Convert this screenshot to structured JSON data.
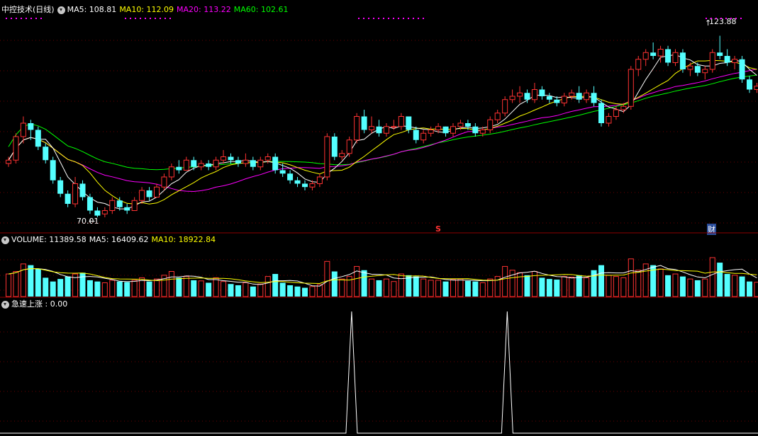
{
  "panels": {
    "price": {
      "title": "中控技术(日线)",
      "indicators": [
        {
          "label": "MA5: 108.81",
          "color": "#ffffff"
        },
        {
          "label": "MA10: 112.09",
          "color": "#ffff00"
        },
        {
          "label": "MA20: 113.22",
          "color": "#ff00ff"
        },
        {
          "label": "MA60: 102.61",
          "color": "#00ff00"
        }
      ],
      "high_label": "123.88",
      "low_label": "70.01",
      "marker_s": "S",
      "marker_cai": "财"
    },
    "volume": {
      "title": "VOLUME: 11389.58",
      "indicators": [
        {
          "label": "MA5: 16409.62",
          "color": "#ffffff"
        },
        {
          "label": "MA10: 18922.84",
          "color": "#ffff00"
        }
      ]
    },
    "signal": {
      "title": "急速上涨 : 0.00"
    }
  },
  "colors": {
    "up": "#ff3232",
    "down": "#54ffff",
    "ma5": "#ffffff",
    "ma10": "#ffff00",
    "ma20": "#ff00ff",
    "ma60": "#00ff00",
    "grid": "#8b0000",
    "dots": "#ff00ff"
  },
  "chart_data": {
    "type": "candlestick",
    "price_range": [
      66,
      130
    ],
    "candles": [
      [
        86,
        88,
        85,
        87
      ],
      [
        87,
        95,
        86,
        94
      ],
      [
        94,
        100,
        92,
        98
      ],
      [
        98,
        99,
        93,
        96
      ],
      [
        96,
        97,
        90,
        91
      ],
      [
        91,
        92,
        86,
        87
      ],
      [
        87,
        88,
        80,
        81
      ],
      [
        81,
        82,
        76,
        77
      ],
      [
        77,
        78,
        73,
        74
      ],
      [
        74,
        82,
        73,
        80
      ],
      [
        80,
        81,
        75,
        76
      ],
      [
        76,
        77,
        71,
        72
      ],
      [
        72,
        73,
        70,
        70.5
      ],
      [
        71,
        73,
        70,
        72
      ],
      [
        72,
        76,
        71,
        75
      ],
      [
        75,
        76,
        72,
        73
      ],
      [
        73,
        74,
        71,
        72
      ],
      [
        72,
        76,
        72,
        75
      ],
      [
        75,
        79,
        74,
        78
      ],
      [
        78,
        79,
        75,
        76
      ],
      [
        76,
        80,
        76,
        79
      ],
      [
        79,
        83,
        78,
        82
      ],
      [
        82,
        86,
        81,
        85
      ],
      [
        85,
        87,
        83,
        84
      ],
      [
        84,
        88,
        84,
        87
      ],
      [
        87,
        88,
        84,
        85
      ],
      [
        85,
        87,
        84,
        86
      ],
      [
        86,
        87,
        84,
        85
      ],
      [
        85,
        88,
        84,
        87
      ],
      [
        87,
        90,
        86,
        88
      ],
      [
        88,
        89,
        86,
        87
      ],
      [
        87,
        88,
        85,
        86
      ],
      [
        86,
        89,
        85,
        87
      ],
      [
        87,
        88,
        84,
        85
      ],
      [
        85,
        88,
        84,
        87
      ],
      [
        87,
        89,
        86,
        88
      ],
      [
        88,
        89,
        83,
        84
      ],
      [
        84,
        86,
        82,
        83
      ],
      [
        83,
        84,
        80,
        81
      ],
      [
        81,
        82,
        79,
        80
      ],
      [
        80,
        81,
        78,
        79
      ],
      [
        79,
        81,
        78,
        80
      ],
      [
        80,
        83,
        79,
        82
      ],
      [
        82,
        95,
        81,
        94
      ],
      [
        94,
        95,
        87,
        88
      ],
      [
        88,
        90,
        87,
        89
      ],
      [
        89,
        94,
        88,
        93
      ],
      [
        93,
        101,
        92,
        100
      ],
      [
        100,
        102,
        95,
        96
      ],
      [
        96,
        100,
        95,
        97
      ],
      [
        97,
        99,
        94,
        95
      ],
      [
        95,
        98,
        94,
        97
      ],
      [
        97,
        99,
        96,
        97
      ],
      [
        97,
        101,
        96,
        100
      ],
      [
        100,
        100,
        95,
        96
      ],
      [
        96,
        97,
        92,
        93
      ],
      [
        93,
        96,
        92,
        95
      ],
      [
        95,
        97,
        94,
        96
      ],
      [
        96,
        98,
        95,
        97
      ],
      [
        97,
        97,
        94,
        95
      ],
      [
        95,
        98,
        94,
        97
      ],
      [
        97,
        99,
        96,
        98
      ],
      [
        98,
        99,
        96,
        97
      ],
      [
        97,
        98,
        94,
        95
      ],
      [
        95,
        97,
        94,
        96
      ],
      [
        96,
        100,
        95,
        99
      ],
      [
        99,
        102,
        98,
        101
      ],
      [
        101,
        106,
        100,
        105
      ],
      [
        105,
        108,
        104,
        106
      ],
      [
        106,
        109,
        104,
        107
      ],
      [
        107,
        108,
        104,
        105
      ],
      [
        105,
        110,
        104,
        108
      ],
      [
        108,
        109,
        105,
        106
      ],
      [
        106,
        107,
        104,
        105
      ],
      [
        105,
        106,
        103,
        104
      ],
      [
        104,
        107,
        103,
        106
      ],
      [
        106,
        108,
        105,
        107
      ],
      [
        107,
        109,
        104,
        105
      ],
      [
        105,
        108,
        104,
        107
      ],
      [
        107,
        109,
        103,
        104
      ],
      [
        104,
        105,
        97,
        98
      ],
      [
        98,
        101,
        97,
        100
      ],
      [
        100,
        103,
        99,
        102
      ],
      [
        102,
        104,
        101,
        103
      ],
      [
        103,
        115,
        102,
        114
      ],
      [
        114,
        118,
        112,
        117
      ],
      [
        117,
        120,
        115,
        119
      ],
      [
        119,
        122,
        117,
        118
      ],
      [
        118,
        121,
        116,
        120
      ],
      [
        120,
        121,
        115,
        116
      ],
      [
        116,
        120,
        115,
        119
      ],
      [
        119,
        120,
        113,
        114
      ],
      [
        114,
        116,
        112,
        115
      ],
      [
        115,
        116,
        112,
        113
      ],
      [
        113,
        115,
        111,
        114
      ],
      [
        114,
        120,
        113,
        119
      ],
      [
        119,
        124,
        117,
        118
      ],
      [
        118,
        120,
        115,
        116
      ],
      [
        116,
        118,
        114,
        117
      ],
      [
        117,
        118,
        110,
        111
      ],
      [
        111,
        112,
        107,
        108
      ],
      [
        108,
        110,
        107,
        109
      ]
    ],
    "volume_range": [
      0,
      40000
    ],
    "volume": [
      18000,
      20000,
      26000,
      25000,
      22000,
      15000,
      12000,
      14000,
      16000,
      18000,
      19000,
      13000,
      12000,
      11000,
      13000,
      12000,
      11500,
      13000,
      15000,
      12000,
      14000,
      17000,
      20000,
      15000,
      16000,
      13000,
      12500,
      11000,
      15000,
      12000,
      10000,
      9000,
      11000,
      8000,
      10000,
      16000,
      18000,
      11000,
      9000,
      8000,
      7000,
      8000,
      9500,
      28000,
      20000,
      14000,
      16000,
      24000,
      21000,
      14000,
      13000,
      14000,
      12000,
      18000,
      17000,
      16000,
      14000,
      13000,
      13000,
      12000,
      13500,
      14000,
      12500,
      12000,
      11000,
      14000,
      16000,
      24000,
      21000,
      19000,
      17000,
      20000,
      15000,
      14000,
      13500,
      16000,
      15500,
      17000,
      15000,
      21000,
      25000,
      17000,
      16000,
      15000,
      30000,
      21000,
      26000,
      25000,
      22000,
      17000,
      18000,
      16000,
      14000,
      13000,
      14000,
      31000,
      27000,
      18000,
      17000,
      16000,
      12000,
      11389.58
    ],
    "signal_spikes": [
      42,
      63
    ]
  }
}
